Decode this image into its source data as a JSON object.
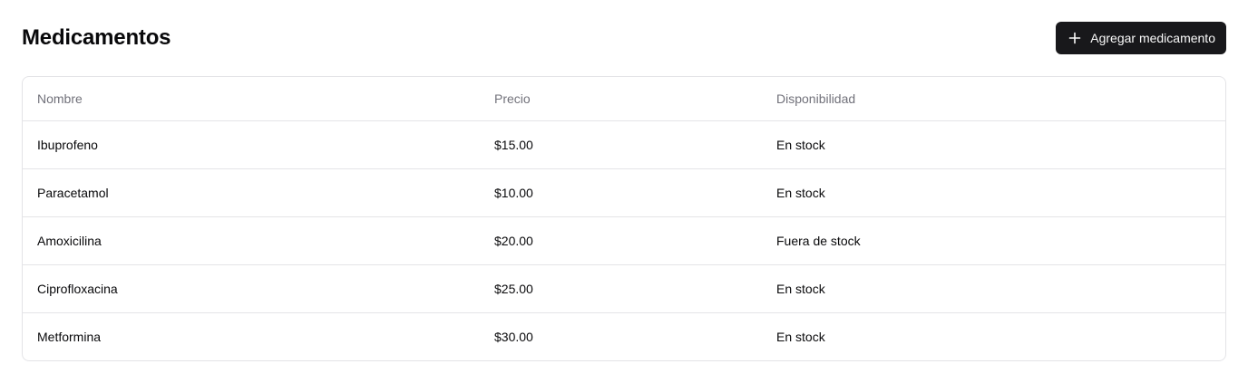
{
  "page": {
    "title": "Medicamentos",
    "add_button_label": "Agregar medicamento",
    "add_button_icon": "plus-icon"
  },
  "table": {
    "columns": [
      "Nombre",
      "Precio",
      "Disponibilidad"
    ],
    "rows": [
      {
        "nombre": "Ibuprofeno",
        "precio": "$15.00",
        "disponibilidad": "En stock"
      },
      {
        "nombre": "Paracetamol",
        "precio": "$10.00",
        "disponibilidad": "En stock"
      },
      {
        "nombre": "Amoxicilina",
        "precio": "$20.00",
        "disponibilidad": "Fuera de stock"
      },
      {
        "nombre": "Ciprofloxacina",
        "precio": "$25.00",
        "disponibilidad": "En stock"
      },
      {
        "nombre": "Metformina",
        "precio": "$30.00",
        "disponibilidad": "En stock"
      }
    ]
  },
  "colors": {
    "button_bg": "#18181b",
    "border": "#e4e4e7",
    "header_text": "#71717a"
  }
}
